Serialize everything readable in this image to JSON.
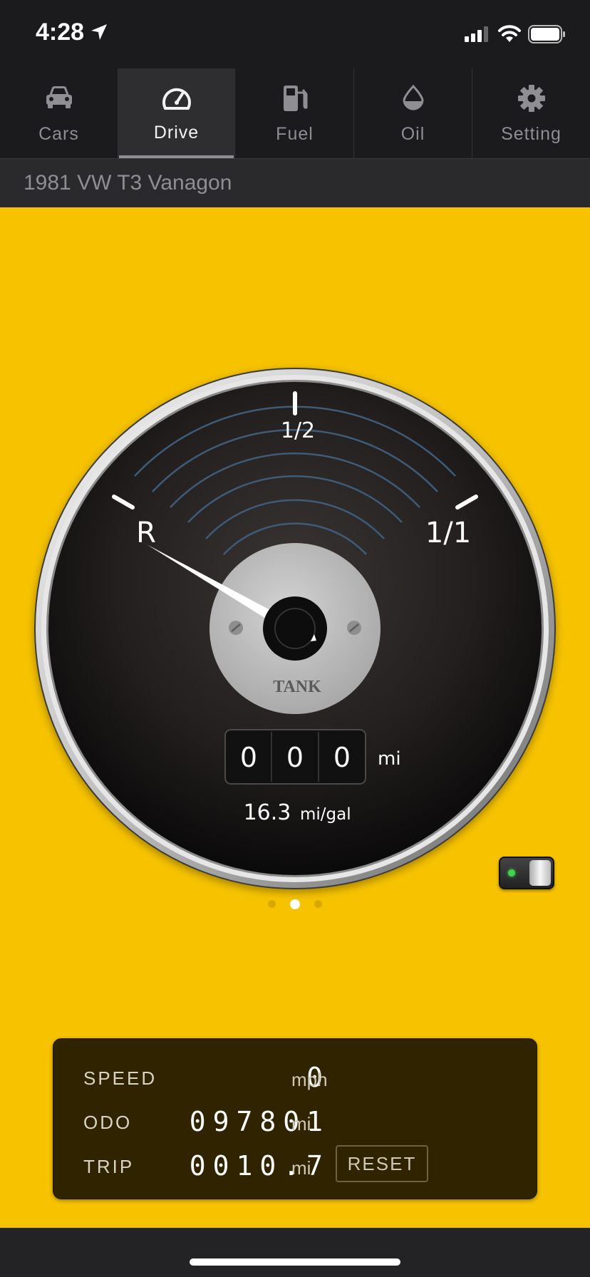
{
  "status_bar": {
    "time": "4:28"
  },
  "tabs": [
    {
      "label": "Cars",
      "icon": "car-icon",
      "active": false
    },
    {
      "label": "Drive",
      "icon": "speedometer-icon",
      "active": true
    },
    {
      "label": "Fuel",
      "icon": "fuel-pump-icon",
      "active": false
    },
    {
      "label": "Oil",
      "icon": "oil-drop-icon",
      "active": false
    },
    {
      "label": "Setting",
      "icon": "gear-icon",
      "active": false
    }
  ],
  "car_name": "1981 VW T3 Vanagon",
  "gauge": {
    "label_reserve": "R",
    "label_half": "1/2",
    "label_full": "1/1",
    "center_label": "TANK",
    "needle_level": "R",
    "odometer_digits": [
      "0",
      "0",
      "0"
    ],
    "odometer_unit": "mi",
    "economy_value": "16.3",
    "economy_unit": "mi/gal"
  },
  "page_indicator": {
    "count": 3,
    "active_index": 1
  },
  "toggle": {
    "on": true,
    "led_color": "#3ed34a"
  },
  "panel": {
    "speed_label": "SPEED",
    "speed_value": "0",
    "speed_unit": "mph",
    "odo_label": "ODO",
    "odo_value": "097801",
    "odo_unit": "mi",
    "trip_label": "TRIP",
    "trip_value": "0010.7",
    "trip_unit": "mi",
    "reset_label": "RESET"
  },
  "colors": {
    "background": "#f7c300",
    "panel": "#302300",
    "bar": "#1b1b1d"
  }
}
